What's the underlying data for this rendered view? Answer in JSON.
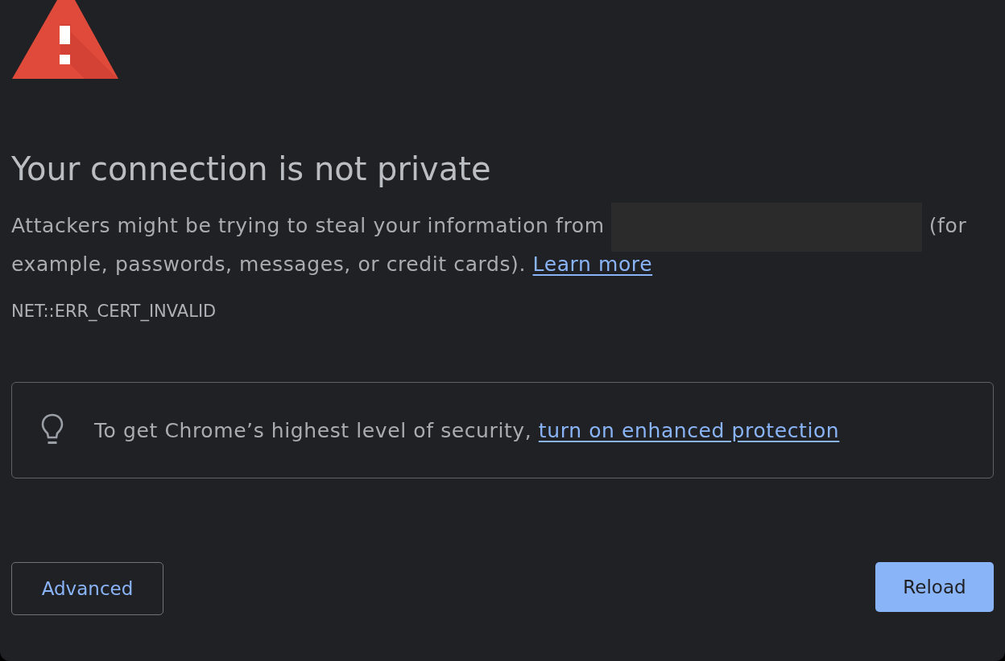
{
  "heading": "Your connection is not private",
  "description": {
    "text_before": "Attackers might be trying to steal your information from",
    "host_redacted": true,
    "text_after": "(for example, passwords, messages, or credit cards).",
    "link": "Learn more"
  },
  "error_code": "NET::ERR_CERT_INVALID",
  "security_tip": {
    "text": "To get Chrome’s highest level of security,",
    "link": "turn on enhanced protection"
  },
  "buttons": [
    {
      "label": "Advanced",
      "kind": "secondary"
    },
    {
      "label": "Reload",
      "kind": "primary"
    }
  ]
}
